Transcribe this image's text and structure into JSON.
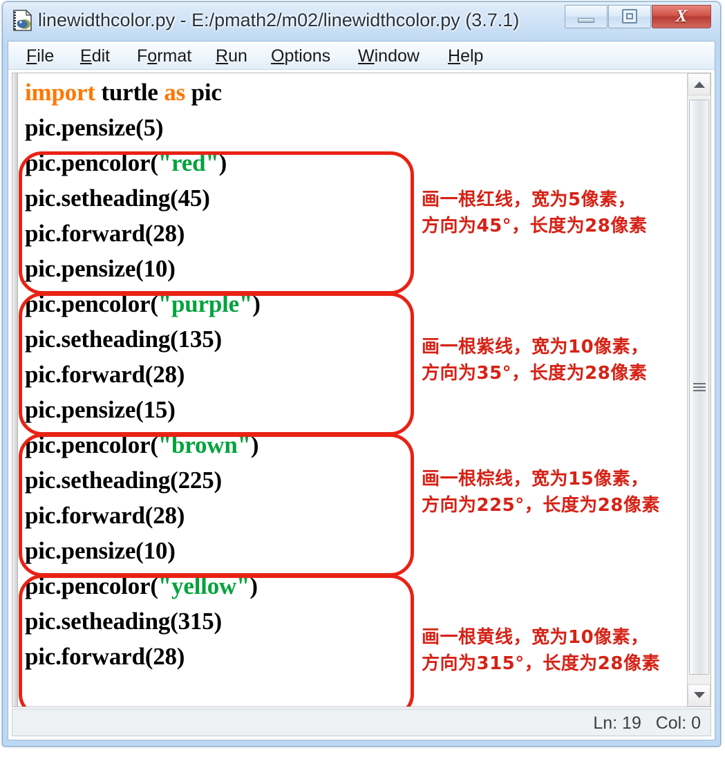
{
  "window": {
    "title": "linewidthcolor.py - E:/pmath2/m02/linewidthcolor.py (3.7.1)",
    "icon": "python-file-icon",
    "controls": {
      "minimize": "–",
      "maximize": "□",
      "close": "X"
    }
  },
  "menubar": {
    "items": [
      {
        "pre": "",
        "mnemonic": "F",
        "post": "ile"
      },
      {
        "pre": "",
        "mnemonic": "E",
        "post": "dit"
      },
      {
        "pre": "F",
        "mnemonic": "o",
        "post": "rmat"
      },
      {
        "pre": "",
        "mnemonic": "R",
        "post": "un"
      },
      {
        "pre": "",
        "mnemonic": "O",
        "post": "ptions"
      },
      {
        "pre": "",
        "mnemonic": "W",
        "post": "indow"
      },
      {
        "pre": "",
        "mnemonic": "H",
        "post": "elp"
      }
    ]
  },
  "editor": {
    "import_line": {
      "kw1": "import",
      "mod": " turtle ",
      "kw2": "as",
      "alias": " pic"
    },
    "blocks": [
      {
        "pensize": "pic.pensize(5)",
        "pencolor_pre": "pic.pencolor(",
        "pencolor_str": "\"red\"",
        "pencolor_post": ")",
        "setheading": "pic.setheading(45)",
        "forward": "pic.forward(28)",
        "note": "画一根红线，宽为5像素，\n方向为45°，长度为28像素"
      },
      {
        "pensize": "pic.pensize(10)",
        "pencolor_pre": "pic.pencolor(",
        "pencolor_str": "\"purple\"",
        "pencolor_post": ")",
        "setheading": "pic.setheading(135)",
        "forward": "pic.forward(28)",
        "note": "画一根紫线，宽为10像素，\n方向为35°，长度为28像素"
      },
      {
        "pensize": "pic.pensize(15)",
        "pencolor_pre": "pic.pencolor(",
        "pencolor_str": "\"brown\"",
        "pencolor_post": ")",
        "setheading": "pic.setheading(225)",
        "forward": "pic.forward(28)",
        "note": "画一根棕线，宽为15像素，\n方向为225°，长度为28像素"
      },
      {
        "pensize": "pic.pensize(10)",
        "pencolor_pre": "pic.pencolor(",
        "pencolor_str": "\"yellow\"",
        "pencolor_post": ")",
        "setheading": "pic.setheading(315)",
        "forward": "pic.forward(28)",
        "note": "画一根黄线，宽为10像素，\n方向为315°，长度为28像素"
      }
    ]
  },
  "statusbar": {
    "position": "Ln: 19   Col: 0"
  },
  "colors": {
    "keyword": "#ff7700",
    "string": "#00a33c",
    "annotation_red": "#d62216",
    "box_red": "#e82214",
    "close_button": "#c0392b"
  }
}
